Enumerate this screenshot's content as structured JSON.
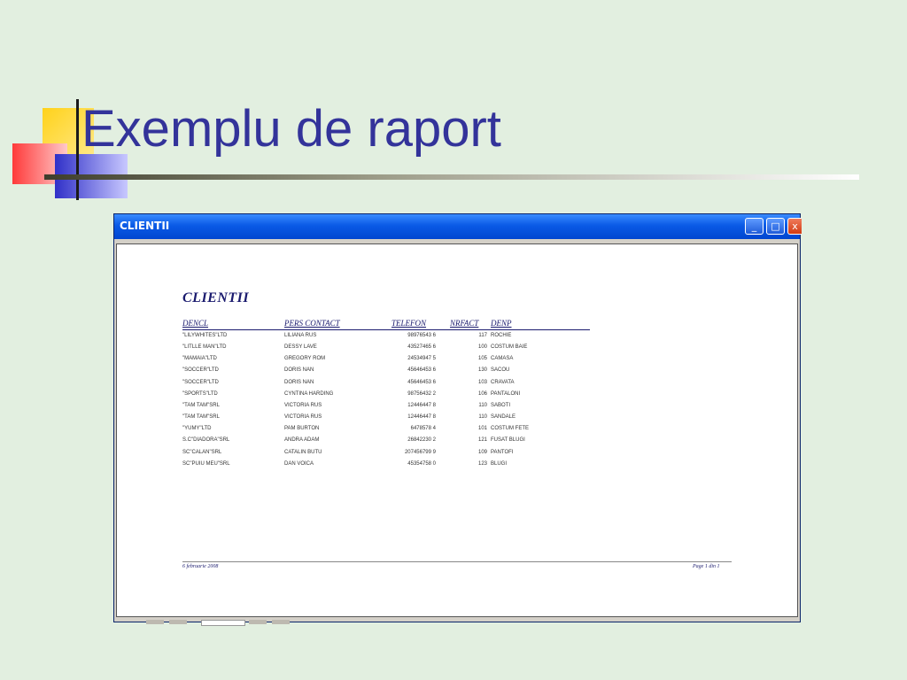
{
  "slide": {
    "title": "Exemplu de raport"
  },
  "window": {
    "title": "CLIENTII",
    "controls": {
      "minimize": "_",
      "maximize": "□",
      "close": "x"
    }
  },
  "report": {
    "title": "CLIENTII",
    "columns": [
      "DENCL",
      "PERS CONTACT",
      "TELEFON",
      "NRFACT",
      "DENP"
    ],
    "rows": [
      [
        "\"LILYWHITES\"LTD",
        "LILIANA RUS",
        "98976543 6",
        "117",
        "ROCHIE"
      ],
      [
        "\"LITLLE MAN\"LTD",
        "DESSY LAVE",
        "43527465 6",
        "100",
        "COSTUM BAIE"
      ],
      [
        "\"MAMAIA\"LTD",
        "GREGORY ROM",
        "24534947 5",
        "105",
        "CAMASA"
      ],
      [
        "\"SOCCER\"LTD",
        "DORIS NAN",
        "45646453 6",
        "130",
        "SACOU"
      ],
      [
        "\"SOCCER\"LTD",
        "DORIS NAN",
        "45646453 6",
        "103",
        "CRAVATA"
      ],
      [
        "\"SPORTS\"LTD",
        "CYNTINA HARDING",
        "98756432 2",
        "106",
        "PANTALONI"
      ],
      [
        "\"TAM TAM\"SRL",
        "VICTORIA RUS",
        "12446447 8",
        "110",
        "SABOTI"
      ],
      [
        "\"TAM TAM\"SRL",
        "VICTORIA RUS",
        "12446447 8",
        "110",
        "SANDALE"
      ],
      [
        "\"YUMY\"LTD",
        "PAM BURTON",
        "6478578 4",
        "101",
        "COSTUM FETE"
      ],
      [
        "S.C\"DIADORA\"SRL",
        "ANDRA ADAM",
        "26842230 2",
        "121",
        "FUSAT BLUGI"
      ],
      [
        "SC\"CALAN\"SRL",
        "CATALIN BUTU",
        "207456799 9",
        "109",
        "PANTOFI"
      ],
      [
        "SC\"PUIU MEU\"SRL",
        "DAN VOICA",
        "45354758 0",
        "123",
        "BLUGI"
      ]
    ],
    "footer": {
      "date": "6 februarie 2008",
      "page": "Page 1 din 1"
    }
  }
}
